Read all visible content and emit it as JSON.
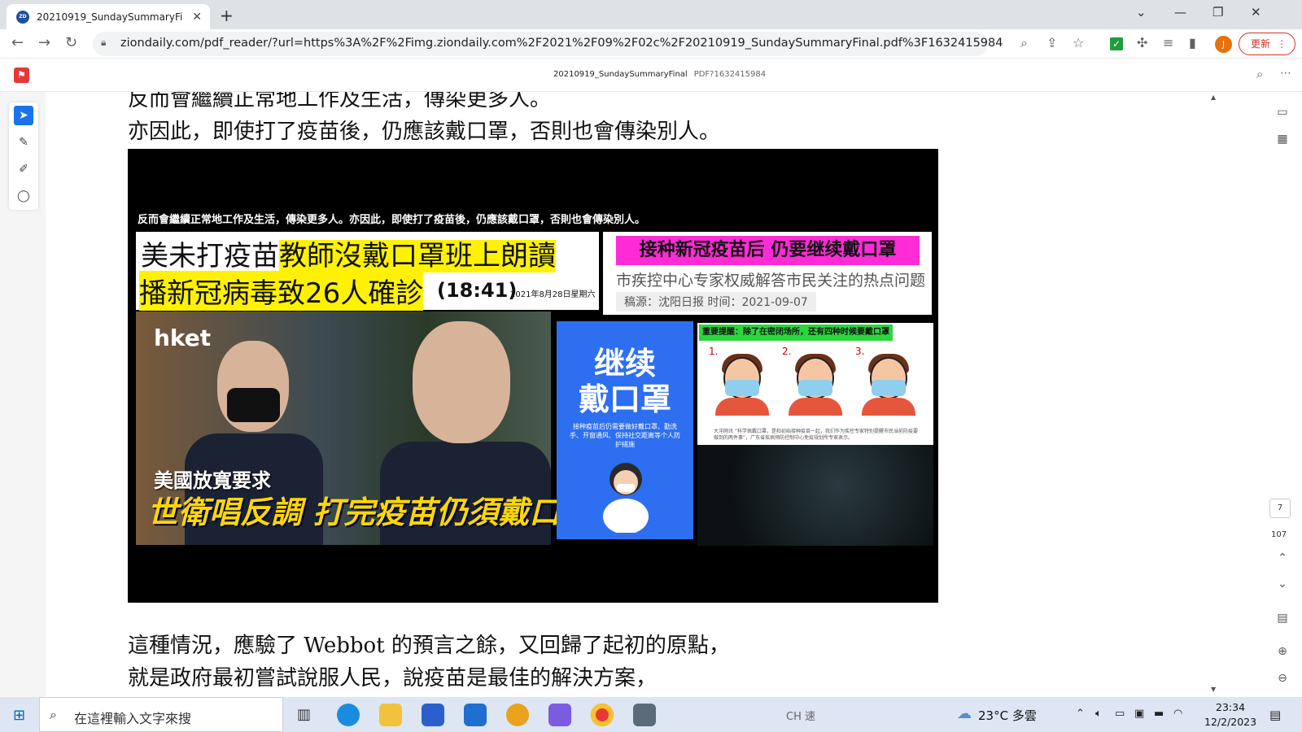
{
  "tab": {
    "title": "20210919_SundaySummaryFin",
    "favicon": "ZD"
  },
  "address": {
    "url": "ziondaily.com/pdf_reader/?url=https%3A%2F%2Fimg.ziondaily.com%2F2021%2F09%2F02c%2F20210919_SundaySummaryFinal.pdf%3F1632415984"
  },
  "profile": {
    "initial": "J"
  },
  "update_label": "更新",
  "pdf": {
    "filename": "20210919_SundaySummaryFinal",
    "suffix": "PDF?1632415984"
  },
  "body": {
    "line0": "反而會繼續正常地工作及生活，傳染更多人。",
    "line1": "亦因此，即使打了疫苗後，仍應該戴口罩，否則也會傳染別人。",
    "line2": "這種情況，應驗了 Webbot 的預言之餘，又回歸了起初的原點，",
    "line3": "就是政府最初嘗試說服人民，說疫苗是最佳的解決方案，"
  },
  "image": {
    "caption": "反而會繼續正常地工作及生活，傳染更多人。亦因此，即使打了疫苗後，仍應該戴口罩，否則也會傳染別人。",
    "headline_a": "美未打疫苗",
    "headline_b": "教師沒戴口罩班上朗讀",
    "headline_c": "播新冠病毒致26人確診",
    "time": "(18:41)",
    "date": "2021年8月28日星期六",
    "right_head": "接种新冠疫苗后 仍要继续戴口罩",
    "right_sub": "市疾控中心专家权威解答市民关注的热点问题",
    "right_source": "稿源：沈阳日报  时间：2021-09-07",
    "logo": "hket",
    "sub1": "美國放寬要求",
    "sub2": "世衛唱反調 打完疫苗仍須戴口罩",
    "blue_title": "继续\n戴口罩",
    "blue_desc": "接种疫苗后仍需要做好戴口罩、勤洗手、开窗通风、保持社交距离等个人防护措施",
    "green_bar": "重要提醒：除了在密闭场所，还有四种时候要戴口罩",
    "figs": [
      "1.",
      "2.",
      "3."
    ],
    "cartoon_note": "大洋网讯 “科学佩戴口罩，是和初始接种疫苗一起，我们作为疾控专家特别提醒市民当前防疫要做到的两件事”，广东省疾病预防控制中心免疫规划所专家表示。"
  },
  "pager": {
    "current": "7",
    "total": "107"
  },
  "taskbar": {
    "search_placeholder": "在這裡輸入文字來搜",
    "ime": "CH 速",
    "weather": "23°C  多雲",
    "time": "23:34",
    "date": "12/2/2023"
  }
}
